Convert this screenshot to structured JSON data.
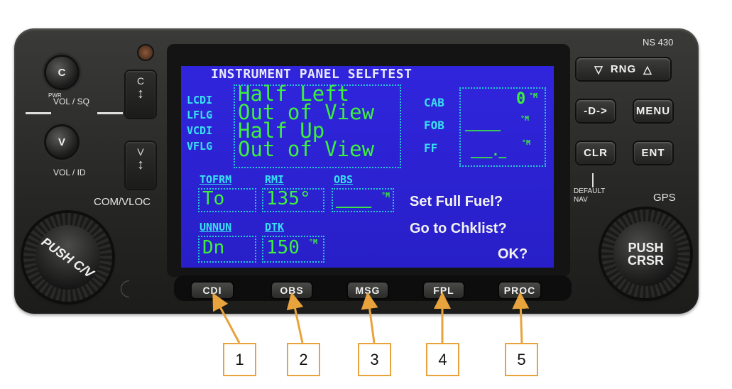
{
  "model": "NS 430",
  "left_panel": {
    "vol_sq_label": "VOL / SQ",
    "pwr_label": "PWR",
    "push_label": "PUSH",
    "vol_id_label": "VOL / ID",
    "com_flip": "C",
    "vloc_flip": "V",
    "com_vloc_label": "COM/VLOC",
    "push_cv": "PUSH C/V"
  },
  "right_panel": {
    "rng_label": "RNG",
    "direct_to": "-D->",
    "menu": "MENU",
    "clr": "CLR",
    "ent": "ENT",
    "default_nav": "DEFAULT NAV",
    "gps": "GPS",
    "push_crsr": "PUSH CRSR"
  },
  "screen": {
    "title": "INSTRUMENT PANEL SELFTEST",
    "rows": [
      {
        "label": "LCDI",
        "value": "Half Left"
      },
      {
        "label": "LFLG",
        "value": "Out of View"
      },
      {
        "label": "VCDI",
        "value": "Half Up"
      },
      {
        "label": "VFLG",
        "value": "Out of View"
      }
    ],
    "cab": {
      "label": "CAB",
      "value": "0",
      "unit": "°M"
    },
    "fob": {
      "label": "FOB",
      "value": "_____",
      "unit": "°M"
    },
    "ff": {
      "label": "FF",
      "value": "___._",
      "unit": "°M"
    },
    "tofrm": {
      "label": "TOFRM",
      "value": "To"
    },
    "rmi": {
      "label": "RMI",
      "value": "135°"
    },
    "obs": {
      "label": "OBS",
      "value": "_____",
      "unit": "°M"
    },
    "unnun": {
      "label": "UNNUN",
      "value": "Dn"
    },
    "dtk": {
      "label": "DTK",
      "value": "150",
      "unit": "°M"
    },
    "prompts": [
      "Set Full Fuel?",
      "Go to Chklist?",
      "OK?"
    ]
  },
  "softkeys": [
    "CDI",
    "OBS",
    "MSG",
    "FPL",
    "PROC"
  ],
  "callouts": [
    "1",
    "2",
    "3",
    "4",
    "5"
  ],
  "colors": {
    "screen_bg": "#2d23d6",
    "text_green": "#3cf03c",
    "label_cyan": "#38e0f0",
    "callout": "#e8a33c"
  }
}
